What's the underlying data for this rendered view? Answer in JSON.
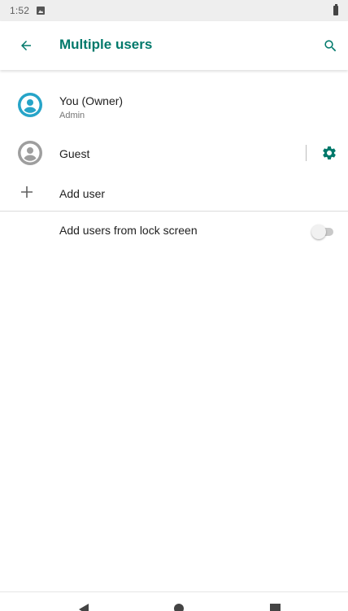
{
  "status_bar": {
    "time": "1:52",
    "notification_icon": "image-notification-icon",
    "battery_icon": "battery-icon"
  },
  "app_bar": {
    "title": "Multiple users",
    "back_icon": "arrow-back-icon",
    "search_icon": "search-icon"
  },
  "users": {
    "owner": {
      "name": "You (Owner)",
      "role": "Admin",
      "avatar_icon": "account-circle-icon"
    },
    "guest": {
      "name": "Guest",
      "avatar_icon": "account-circle-icon",
      "settings_icon": "gear-icon"
    },
    "add_user": {
      "label": "Add user",
      "icon": "plus-icon"
    }
  },
  "lock_screen": {
    "label": "Add users from lock screen",
    "toggle_on": false
  },
  "nav_bar": {
    "back_icon": "nav-back-icon",
    "home_icon": "nav-home-icon",
    "recents_icon": "nav-recents-icon"
  },
  "colors": {
    "accent": "#00796b",
    "owner_avatar": "#26a4c8",
    "guest_avatar": "#9e9e9e"
  }
}
